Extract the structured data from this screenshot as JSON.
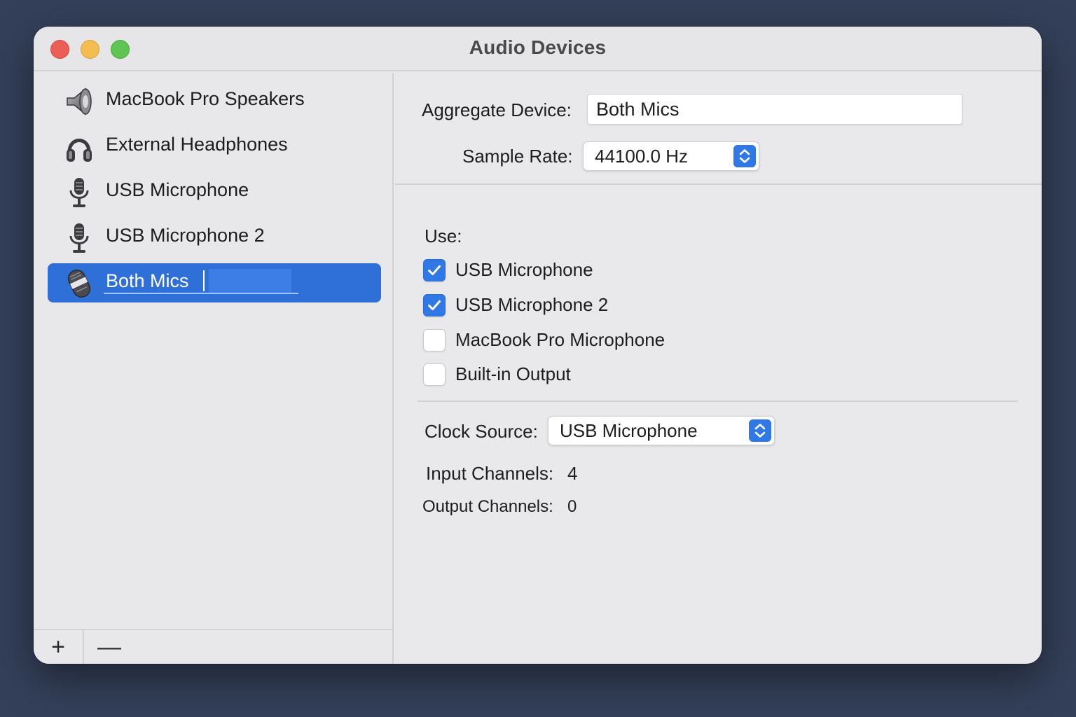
{
  "window": {
    "title": "Audio Devices"
  },
  "sidebar": {
    "devices": [
      {
        "label": "MacBook Pro Speakers",
        "icon": "speaker-icon"
      },
      {
        "label": "External Headphones",
        "icon": "headphones-icon"
      },
      {
        "label": "USB Microphone",
        "icon": "microphone-icon"
      },
      {
        "label": "USB Microphone 2",
        "icon": "microphone-icon"
      },
      {
        "label": "Both Mics",
        "icon": "aggregate-microphone-icon",
        "selected": true,
        "editing": true
      }
    ],
    "footer": {
      "add_label": "+",
      "remove_label": "—"
    }
  },
  "detail": {
    "aggregate_device_label": "Aggregate Device:",
    "aggregate_device_value": "Both Mics",
    "sample_rate_label": "Sample Rate:",
    "sample_rate_value": "44100.0 Hz",
    "use_label": "Use:",
    "use_items": [
      {
        "label": "USB Microphone",
        "checked": true
      },
      {
        "label": "USB Microphone 2",
        "checked": true
      },
      {
        "label": "MacBook Pro Microphone",
        "checked": false
      },
      {
        "label": "Built-in Output",
        "checked": false
      }
    ],
    "clock_source_label": "Clock Source:",
    "clock_source_value": "USB Microphone",
    "input_channels_label": "Input Channels:",
    "input_channels_value": "4",
    "output_channels_label": "Output Channels:",
    "output_channels_value": "0"
  },
  "colors": {
    "accent": "#2f78e6",
    "selection": "#2f6fd8",
    "desktop": "#34405a"
  }
}
